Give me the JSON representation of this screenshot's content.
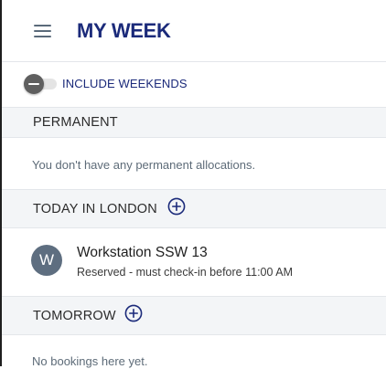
{
  "header": {
    "title": "MY WEEK",
    "menu_icon": "hamburger-menu-icon"
  },
  "weekend_toggle": {
    "label": "INCLUDE WEEKENDS",
    "checked": false
  },
  "sections": {
    "permanent": {
      "title": "PERMANENT",
      "empty_text": "You don't have any permanent allocations."
    },
    "today": {
      "title": "TODAY IN LONDON",
      "add_icon": "plus-circle-icon",
      "booking": {
        "avatar_letter": "W",
        "title": "Workstation SSW 13",
        "status": "Reserved - must check-in before 11:00 AM"
      }
    },
    "tomorrow": {
      "title": "TOMORROW",
      "add_icon": "plus-circle-icon",
      "empty_text": "No bookings here yet."
    }
  },
  "colors": {
    "brand": "#1b2a7a",
    "section_bg": "#f3f5f7",
    "avatar_bg": "#5e6e80",
    "muted_text": "#5d6b78"
  }
}
